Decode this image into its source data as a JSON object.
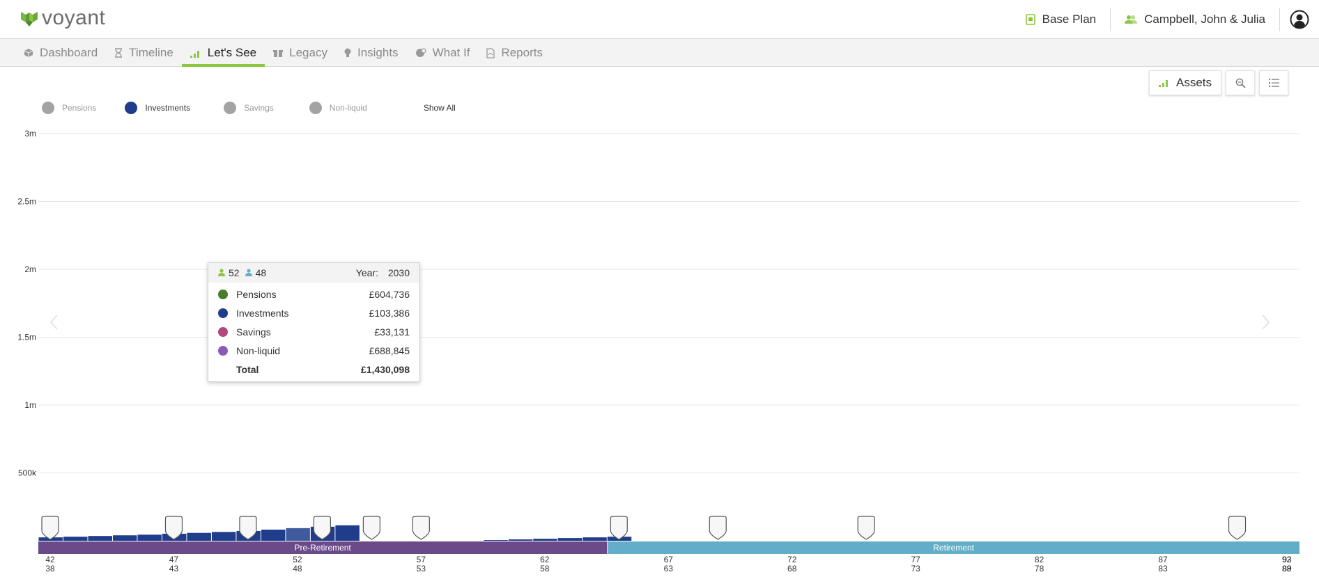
{
  "brand": {
    "name": "voyant",
    "accent": "#8dc63f"
  },
  "header": {
    "plan_label": "Base Plan",
    "client_label": "Campbell, John & Julia"
  },
  "nav": {
    "tabs": [
      {
        "label": "Dashboard",
        "icon": "cube-icon"
      },
      {
        "label": "Timeline",
        "icon": "hourglass-icon"
      },
      {
        "label": "Let's See",
        "icon": "bar-chart-icon",
        "active": true
      },
      {
        "label": "Legacy",
        "icon": "gift-icon"
      },
      {
        "label": "Insights",
        "icon": "lightbulb-icon"
      },
      {
        "label": "What If",
        "icon": "what-if-icon"
      },
      {
        "label": "Reports",
        "icon": "pdf-icon"
      }
    ]
  },
  "toolbar": {
    "assets_label": "Assets"
  },
  "legend": {
    "items": [
      {
        "label": "Pensions",
        "color": "#a3a3a3",
        "active": false
      },
      {
        "label": "Investments",
        "color": "#1f3d8a",
        "active": true
      },
      {
        "label": "Savings",
        "color": "#a3a3a3",
        "active": false
      },
      {
        "label": "Non-liquid",
        "color": "#a3a3a3",
        "active": false
      }
    ],
    "show_all_label": "Show All"
  },
  "tooltip": {
    "age_1": "52",
    "age_2": "48",
    "year_label": "Year:",
    "year": "2030",
    "rows": [
      {
        "label": "Pensions",
        "value": "£604,736",
        "color": "#4a7a2c"
      },
      {
        "label": "Investments",
        "value": "£103,386",
        "color": "#1f3d8a"
      },
      {
        "label": "Savings",
        "value": "£33,131",
        "color": "#b5467e"
      },
      {
        "label": "Non-liquid",
        "value": "£688,845",
        "color": "#8a5bb8"
      }
    ],
    "total_label": "Total",
    "total_value": "£1,430,098"
  },
  "chart_data": {
    "type": "bar",
    "y_ticks": [
      {
        "value": 500000,
        "label": "500k"
      },
      {
        "value": 1000000,
        "label": "1m"
      },
      {
        "value": 1500000,
        "label": "1.5m"
      },
      {
        "value": 2000000,
        "label": "2m"
      },
      {
        "value": 2500000,
        "label": "2.5m"
      },
      {
        "value": 3000000,
        "label": "3m"
      }
    ],
    "ylim": [
      0,
      3000000
    ],
    "grid": true,
    "age_start": 42,
    "age_end": 93,
    "series": [
      {
        "name": "Investments",
        "color": "#1f3d8a",
        "values": [
          25000,
          30000,
          35000,
          40000,
          45000,
          52000,
          58000,
          65000,
          72000,
          82000,
          93000,
          103386,
          114000,
          0,
          0,
          0,
          0,
          0,
          5000,
          10000,
          15000,
          20000,
          25000,
          30000,
          0,
          0,
          0,
          0,
          0,
          0,
          0,
          0,
          0,
          0,
          0,
          0,
          0,
          0,
          0,
          0,
          0,
          0,
          0,
          0,
          0,
          0,
          0,
          0,
          0,
          0,
          0,
          0
        ],
        "highlight_index": 10
      }
    ],
    "x_ticks": [
      {
        "age1": "42",
        "age2": "38"
      },
      {
        "age1": "47",
        "age2": "43"
      },
      {
        "age1": "52",
        "age2": "48"
      },
      {
        "age1": "57",
        "age2": "53"
      },
      {
        "age1": "62",
        "age2": "58"
      },
      {
        "age1": "67",
        "age2": "63"
      },
      {
        "age1": "72",
        "age2": "68"
      },
      {
        "age1": "77",
        "age2": "73"
      },
      {
        "age1": "82",
        "age2": "78"
      },
      {
        "age1": "87",
        "age2": "83"
      },
      {
        "age1": "92",
        "age2": "88"
      },
      {
        "age1": "93",
        "age2": "89"
      }
    ],
    "phases": [
      {
        "label": "Pre-Retirement",
        "from_age": 42,
        "to_age": 65,
        "color": "#6b4a8a"
      },
      {
        "label": "Retirement",
        "from_age": 65,
        "to_age": 93,
        "color": "#62aec8"
      }
    ],
    "marker_ages": [
      42,
      47,
      50,
      53,
      55,
      57,
      65,
      69,
      75,
      90
    ]
  }
}
